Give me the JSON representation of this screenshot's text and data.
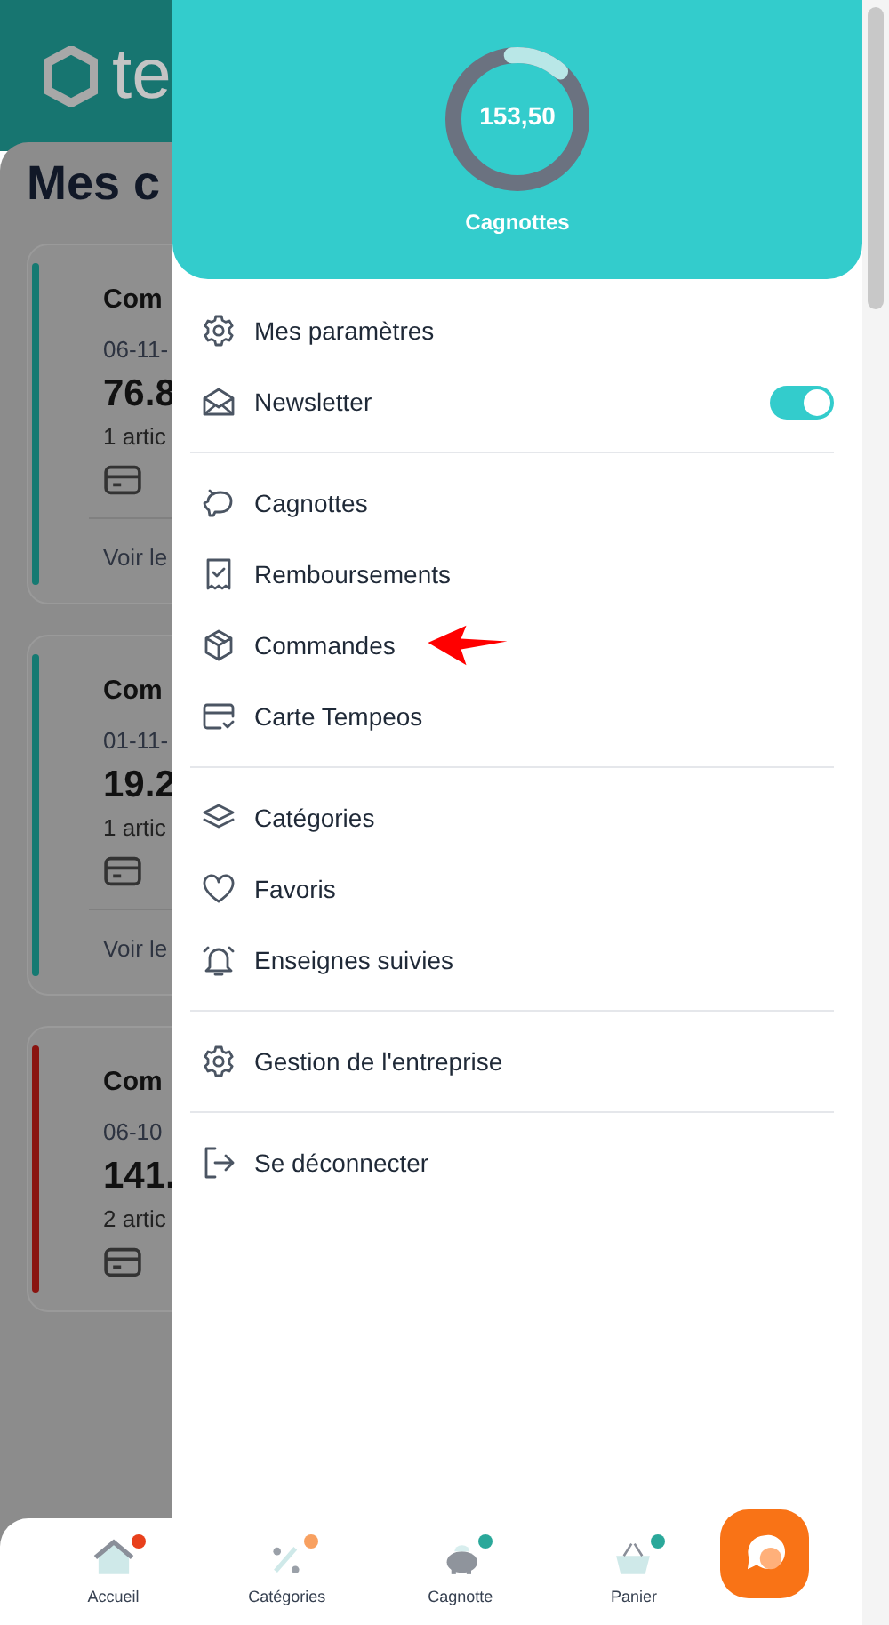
{
  "background_page": {
    "logo_text": "te",
    "title": "Mes c",
    "cards": [
      {
        "title": "Com",
        "date": "06-11-",
        "amount": "76.8",
        "items": "1 artic",
        "link": "Voir le",
        "color": "#167a72"
      },
      {
        "title": "Com",
        "date": "01-11-",
        "amount": "19.2",
        "items": "1 artic",
        "link": "Voir le",
        "color": "#167a72"
      },
      {
        "title": "Com",
        "date": "06-10",
        "amount": "141.",
        "items": "2 artic",
        "color": "#8a1410"
      }
    ]
  },
  "drawer": {
    "balance": {
      "value": "153,50",
      "label": "Cagnottes",
      "level": 0.13
    },
    "groups": [
      [
        {
          "kind": "link",
          "label": "Mes paramètres"
        },
        {
          "kind": "toggle",
          "label": "Newsletter",
          "on": true
        }
      ],
      [
        {
          "kind": "link",
          "label": "Cagnottes"
        },
        {
          "kind": "link",
          "label": "Remboursements"
        },
        {
          "kind": "link",
          "label": "Commandes",
          "annotated": true
        },
        {
          "kind": "link",
          "label": "Carte Tempeos"
        }
      ],
      [
        {
          "kind": "link",
          "label": "Catégories"
        },
        {
          "kind": "link",
          "label": "Favoris"
        },
        {
          "kind": "link",
          "label": "Enseignes suivies"
        }
      ],
      [
        {
          "kind": "link",
          "label": "Gestion de l'entreprise"
        }
      ],
      [
        {
          "kind": "link",
          "label": "Se déconnecter"
        }
      ]
    ]
  },
  "bottom_nav": [
    {
      "label": "Accueil",
      "color": "#e8401c"
    },
    {
      "label": "Catégories",
      "color": "#f8a060"
    },
    {
      "label": "Cagnotte",
      "color": "#2aa89a"
    },
    {
      "label": "Panier",
      "color": "#2aa89a"
    }
  ]
}
